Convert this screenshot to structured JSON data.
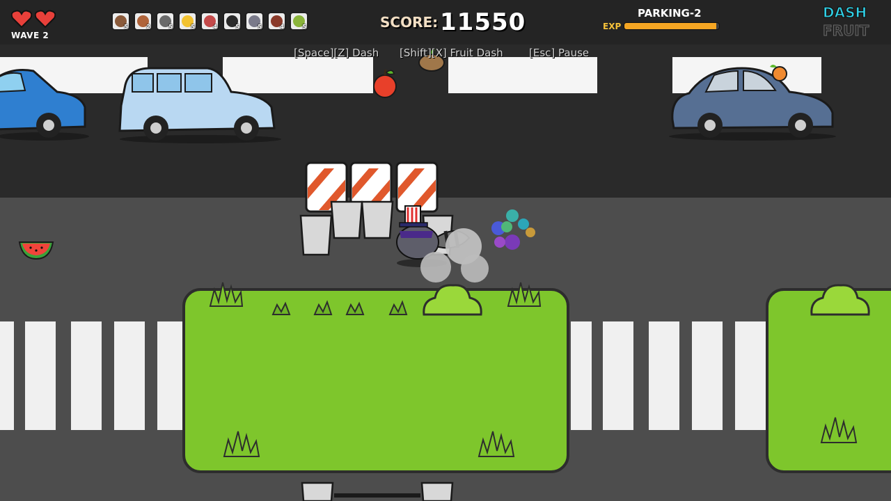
{
  "hud": {
    "hearts": 2,
    "wave_label": "WAVE 2",
    "inventory": [
      {
        "icon": "acorn-icon",
        "count": "5"
      },
      {
        "icon": "squirrel-icon",
        "count": "2"
      },
      {
        "icon": "bird-icon",
        "count": "5"
      },
      {
        "icon": "alarm-clock-icon",
        "count": "5"
      },
      {
        "icon": "heart-potion-icon",
        "count": "4"
      },
      {
        "icon": "bomb-icon",
        "count": "5"
      },
      {
        "icon": "magnet-icon",
        "count": "5"
      },
      {
        "icon": "feather-icon",
        "count": "4"
      },
      {
        "icon": "kiwi-icon",
        "count": "5"
      }
    ],
    "score_label": "SCORE:",
    "score_value": "11550",
    "area_name": "PARKING-2",
    "exp_label": "EXP",
    "exp_fraction": 0.97,
    "logo_line1": "DASH",
    "logo_line2": "FRUIT"
  },
  "controls": {
    "dash": "[Space][Z] Dash",
    "fruit_dash": "[Shift][X] Fruit Dash",
    "pause": "[Esc] Pause"
  },
  "colors": {
    "exp_fill": "#f5a623",
    "grass": "#7ec62c",
    "heart": "#e8403a",
    "logo": "#2fd0e6"
  }
}
